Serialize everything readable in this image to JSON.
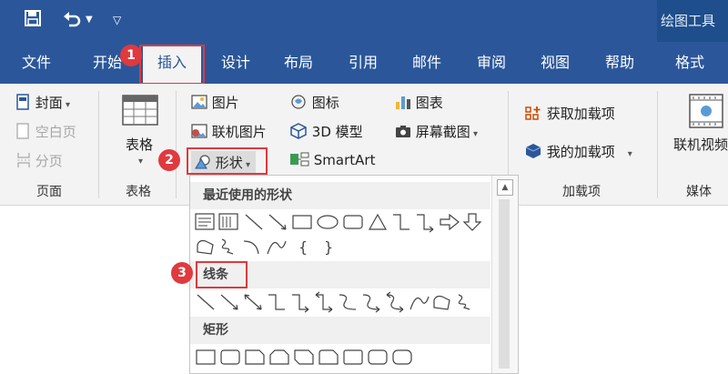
{
  "context_tab": {
    "label": "绘图工具"
  },
  "tabs": [
    {
      "label": "文件"
    },
    {
      "label": "开始"
    },
    {
      "label": "插入"
    },
    {
      "label": "设计"
    },
    {
      "label": "布局"
    },
    {
      "label": "引用"
    },
    {
      "label": "邮件"
    },
    {
      "label": "审阅"
    },
    {
      "label": "视图"
    },
    {
      "label": "帮助"
    },
    {
      "label": "格式"
    }
  ],
  "steps": [
    "1",
    "2",
    "3"
  ],
  "ribbon": {
    "pages_group": {
      "cover": "封面",
      "blank_page": "空白页",
      "page_break": "分页",
      "label": "页面"
    },
    "table_group": {
      "table": "表格",
      "label": "表格"
    },
    "illustrations": {
      "pictures": "图片",
      "online_pictures": "联机图片",
      "shapes": "形状",
      "icons": "图标",
      "models_3d": "3D 模型",
      "smartart": "SmartArt",
      "chart": "图表",
      "screenshot": "屏幕截图"
    },
    "addins_group": {
      "get_addins": "获取加载项",
      "my_addins": "我的加载项",
      "label": "加载项"
    },
    "media_group": {
      "online_video": "联机视频",
      "label": "媒体"
    }
  },
  "shapes_panel": {
    "recent_header": "最近使用的形状",
    "lines_header": "线条",
    "rect_header": "矩形"
  }
}
